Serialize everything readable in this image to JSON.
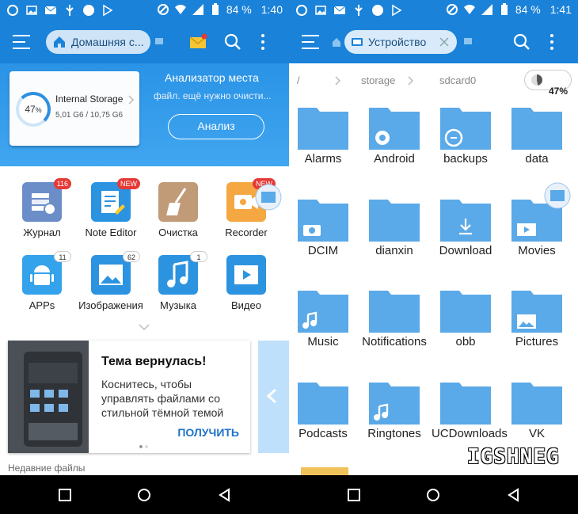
{
  "left": {
    "status": {
      "battery": "84 %",
      "time": "1:40"
    },
    "appbar": {
      "tab_label": "Домашняя с..."
    },
    "storage_card": {
      "percent": "47",
      "percent_sign": "%",
      "name": "Internal Storage",
      "size": "5,01 G6 / 10,75 G6"
    },
    "analyzer": {
      "title": "Анализатор места",
      "subtitle": "файл. ещё нужно очисти...",
      "button": "Анализ"
    },
    "grid": [
      {
        "label": "Журнал",
        "badge": "116"
      },
      {
        "label": "Note Editor",
        "badge": "NEW"
      },
      {
        "label": "Очистка",
        "badge": ""
      },
      {
        "label": "Recorder",
        "badge": "NEW"
      },
      {
        "label": "APPs",
        "badge": "11"
      },
      {
        "label": "Изображения",
        "badge": "62"
      },
      {
        "label": "Музыка",
        "badge": "1"
      },
      {
        "label": "Видео",
        "badge": ""
      }
    ],
    "promo": {
      "title": "Тема вернулась!",
      "text": "Коснитесь, чтобы управлять файлами со стильной тёмной темой",
      "action": "ПОЛУЧИТЬ"
    },
    "bottom_partial": "Недавние файлы"
  },
  "right": {
    "status": {
      "battery": "84 %",
      "time": "1:41"
    },
    "appbar": {
      "tab_label": "Устройство"
    },
    "breadcrumb": [
      "/",
      "storage",
      "sdcard0"
    ],
    "usage": "47%",
    "folders": [
      {
        "name": "Alarms",
        "overlay": ""
      },
      {
        "name": "Android",
        "overlay": "gear"
      },
      {
        "name": "backups",
        "overlay": "es"
      },
      {
        "name": "data",
        "overlay": ""
      },
      {
        "name": "DCIM",
        "overlay": "camera"
      },
      {
        "name": "dianxin",
        "overlay": ""
      },
      {
        "name": "Download",
        "overlay": "download"
      },
      {
        "name": "Movies",
        "overlay": "play"
      },
      {
        "name": "Music",
        "overlay": "music"
      },
      {
        "name": "Notifications",
        "overlay": ""
      },
      {
        "name": "obb",
        "overlay": ""
      },
      {
        "name": "Pictures",
        "overlay": "image"
      },
      {
        "name": "Podcasts",
        "overlay": ""
      },
      {
        "name": "Ringtones",
        "overlay": "music"
      },
      {
        "name": "UCDownloads",
        "overlay": ""
      },
      {
        "name": "VK",
        "overlay": ""
      }
    ]
  },
  "watermark": "IGSHNEG",
  "colors": {
    "appbar": "#1a82d9",
    "folder": "#5aa9e8",
    "accent": "#1e73c8"
  }
}
